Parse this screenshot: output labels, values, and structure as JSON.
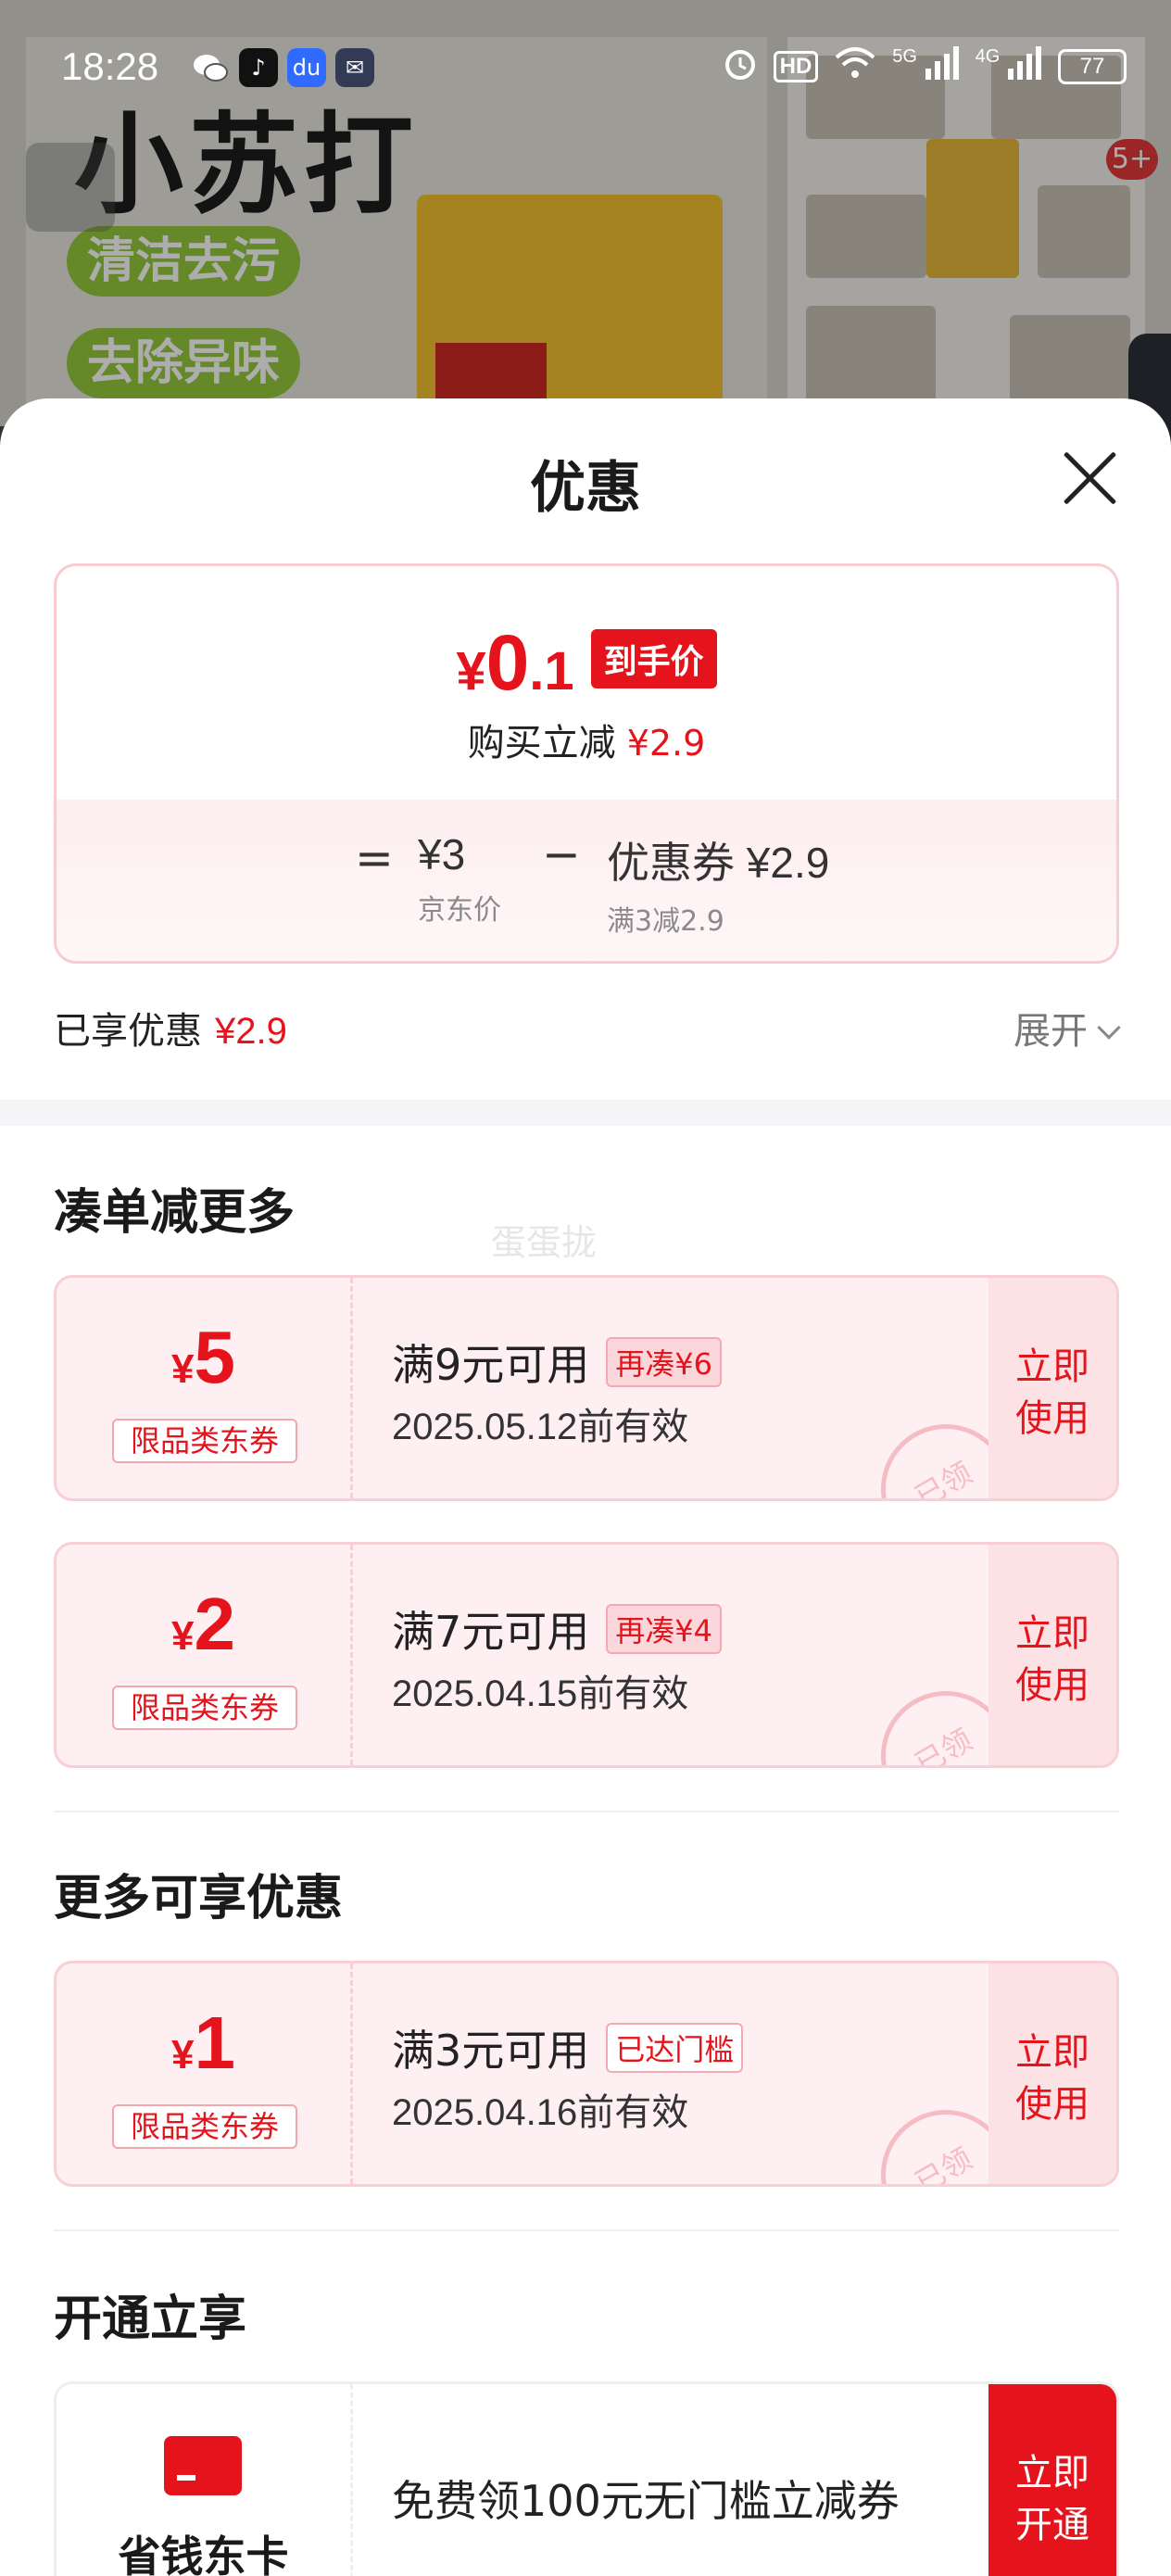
{
  "status_bar": {
    "time": "18:28",
    "battery": "77",
    "signal_labels": [
      "HD",
      "5G",
      "4G"
    ],
    "app_icons": [
      "wechat-icon",
      "tiktok-icon",
      "baidu-icon",
      "mail-icon"
    ]
  },
  "background": {
    "product_title": "小苏打",
    "tags": [
      "清洁去污",
      "去除异味"
    ],
    "badge": "5+"
  },
  "sheet": {
    "title": "优惠",
    "price": {
      "currency": "¥",
      "final_int": "0",
      "final_dec": ".1",
      "final_tag": "到手价",
      "reduction_label": "购买立减",
      "reduction_value": "¥2.9",
      "eq": "=",
      "minus": "−",
      "base_value": "¥3",
      "base_label": "京东价",
      "coupon_value": "优惠券 ¥2.9",
      "coupon_label": "满3减2.9"
    },
    "enjoyed": {
      "label": "已享优惠",
      "value": "¥2.9",
      "expand": "展开"
    },
    "watermark": "蛋蛋拢",
    "sections": {
      "more_title": "凑单减更多",
      "extra_title": "更多可享优惠",
      "open_title": "开通立享"
    },
    "coupons": [
      {
        "currency": "¥",
        "amount": "5",
        "type": "限品类东券",
        "condition": "满9元可用",
        "pill": "再凑¥6",
        "valid": "2025.05.12前有效",
        "button": "立即使用",
        "stamp": "已领"
      },
      {
        "currency": "¥",
        "amount": "2",
        "type": "限品类东券",
        "condition": "满7元可用",
        "pill": "再凑¥4",
        "valid": "2025.04.15前有效",
        "button": "立即使用",
        "stamp": "已领"
      },
      {
        "currency": "¥",
        "amount": "1",
        "type": "限品类东券",
        "condition": "满3元可用",
        "pill": "已达门槛",
        "valid": "2025.04.16前有效",
        "button": "立即使用",
        "stamp": "已领"
      }
    ],
    "member": {
      "name": "省钱东卡",
      "text": "免费领100元无门槛立减券",
      "button": "立即开通"
    }
  }
}
